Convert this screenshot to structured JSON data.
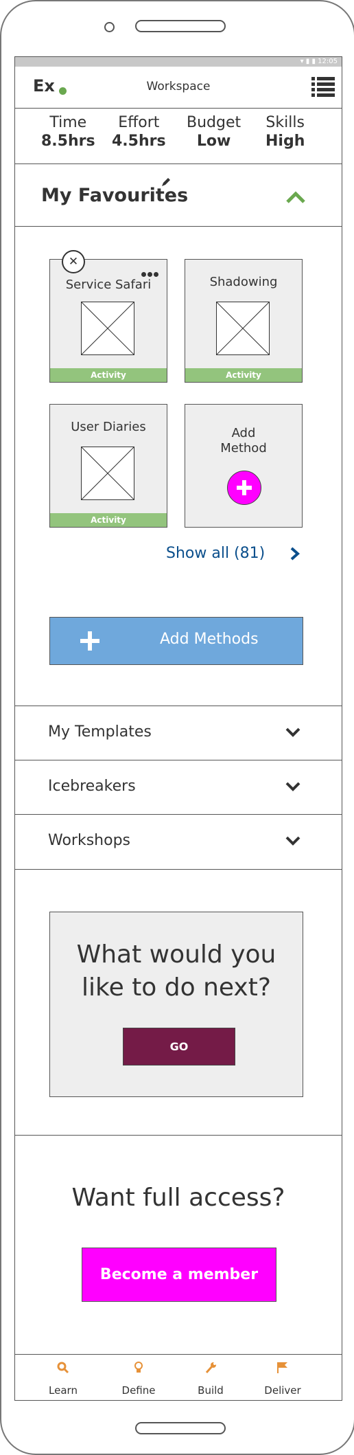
{
  "status_bar": {
    "time": "12:05"
  },
  "header": {
    "logo": "Ex",
    "title": "Workspace"
  },
  "stats": [
    {
      "label": "Time",
      "value": "8.5hrs"
    },
    {
      "label": "Effort",
      "value": "4.5hrs"
    },
    {
      "label": "Budget",
      "value": "Low"
    },
    {
      "label": "Skills",
      "value": "High"
    }
  ],
  "favourites": {
    "title": "My Favourites",
    "cards": [
      {
        "title": "Service Safari",
        "tag": "Activity"
      },
      {
        "title": "Shadowing",
        "tag": "Activity"
      },
      {
        "title": "User Diaries",
        "tag": "Activity"
      }
    ],
    "add_card": {
      "line1": "Add",
      "line2": "Method"
    },
    "show_all": "Show all (81)",
    "add_methods": "Add Methods"
  },
  "sections": [
    {
      "label": "My Templates"
    },
    {
      "label": "Icebreakers"
    },
    {
      "label": "Workshops"
    }
  ],
  "next": {
    "line1": "What would you",
    "line2": "like to do next?",
    "button": "GO"
  },
  "access": {
    "title": "Want full access?",
    "button": "Become a member"
  },
  "tabs": [
    {
      "label": "Learn",
      "icon": "search-icon",
      "color": "#e69138"
    },
    {
      "label": "Define",
      "icon": "lightbulb-icon",
      "color": "#e69138"
    },
    {
      "label": "Build",
      "icon": "wrench-icon",
      "color": "#e69138"
    },
    {
      "label": "Deliver",
      "icon": "flag-icon",
      "color": "#e69138"
    }
  ],
  "colors": {
    "accent_green": "#6aa84f",
    "activity_tag": "#93c47d",
    "link_blue": "#0b4f8c",
    "button_blue": "#6fa8dc",
    "go_button": "#741b47",
    "magenta": "#ff00ff"
  }
}
